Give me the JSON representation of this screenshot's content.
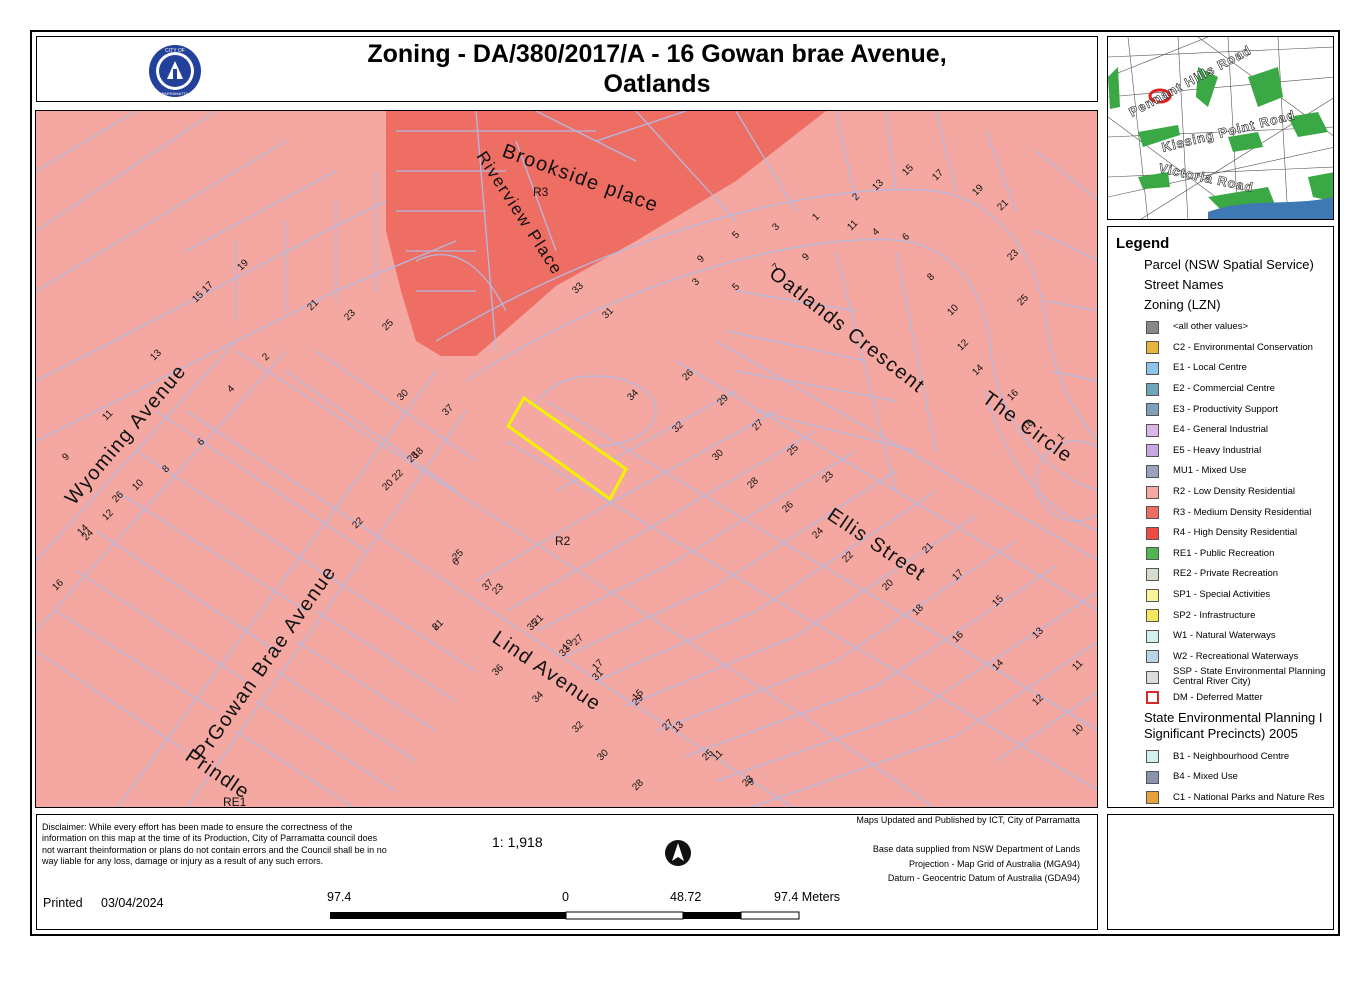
{
  "title": {
    "line1": "Zoning - DA/380/2017/A - 16 Gowan brae Avenue,",
    "line2": "Oatlands"
  },
  "logo": {
    "top_text": "CITY OF",
    "bottom_text": "PARRAMATTA"
  },
  "colors": {
    "R2": "#f4a8a1",
    "R3": "#ef6e64",
    "parcel_line": "#b3b9e0",
    "subject_outline": "#f2f200",
    "inset_green": "#3aa845"
  },
  "map": {
    "streets": {
      "wyoming": "Wyoming Avenue",
      "gowan_brae": "PrGowan Brae Avenue",
      "prindle": "Prindle",
      "lind": "Lind Avenue",
      "ellis": "Ellis Street",
      "oatlands_crescent": "Oatlands Crescent",
      "the_circle": "The Circle",
      "brookside": "Brookside place",
      "riverview": "Riverview Place"
    },
    "zone_labels": {
      "r3": "R3",
      "r2": "R2",
      "re1": "RE1"
    },
    "lot_numbers": [
      "19",
      "15 17",
      "13",
      "11",
      "9",
      "21",
      "23",
      "25",
      "33",
      "31",
      "16",
      "14",
      "12",
      "10",
      "8",
      "6",
      "4",
      "2",
      "30",
      "28",
      "26",
      "24",
      "22",
      "20 22",
      "18",
      "37",
      "27",
      "25",
      "23",
      "21",
      "19",
      "17",
      "15",
      "13",
      "11",
      "9",
      "34",
      "32",
      "30",
      "28",
      "26",
      "24",
      "22",
      "20",
      "18",
      "16",
      "14",
      "12",
      "10",
      "8",
      "6",
      "37",
      "35",
      "33",
      "31",
      "29",
      "27",
      "25",
      "23",
      "21",
      "36",
      "34",
      "32",
      "30",
      "28",
      "26",
      "29",
      "27",
      "25",
      "23",
      "21",
      "17",
      "15",
      "13",
      "11",
      "9",
      "5",
      "3",
      "1",
      "2",
      "4",
      "6",
      "8",
      "10",
      "12",
      "14",
      "16",
      "18",
      "1",
      "3",
      "5",
      "7",
      "9",
      "11",
      "13",
      "15",
      "17",
      "19",
      "21",
      "23",
      "25"
    ]
  },
  "inset": {
    "roads": [
      "Pennant Hills Road",
      "Kissing Point Road",
      "Victoria Road"
    ]
  },
  "legend": {
    "title": "Legend",
    "parcel": "Parcel (NSW Spatial Service)",
    "street_names": "Street Names",
    "zoning_heading": "Zoning (LZN)",
    "zoning_items": [
      {
        "label": "<all other values>",
        "color": "#888888"
      },
      {
        "label": "C2 - Environmental Conservation",
        "color": "#e6b63c"
      },
      {
        "label": "E1 - Local Centre",
        "color": "#8ec4ea"
      },
      {
        "label": "E2 - Commercial Centre",
        "color": "#6da6bb"
      },
      {
        "label": "E3 - Productivity Support",
        "color": "#7fa0b8"
      },
      {
        "label": "E4 - General Industrial",
        "color": "#ddb6e8"
      },
      {
        "label": "E5 - Heavy Industrial",
        "color": "#c6a8e0"
      },
      {
        "label": "MU1 - Mixed Use",
        "color": "#9aa2bd"
      },
      {
        "label": "R2 - Low Density Residential",
        "color": "#f4a8a1"
      },
      {
        "label": "R3 - Medium Density Residential",
        "color": "#ef6e64"
      },
      {
        "label": "R4 - High Density Residential",
        "color": "#f04b43"
      },
      {
        "label": "RE1 - Public Recreation",
        "color": "#52b554"
      },
      {
        "label": "RE2 - Private Recreation",
        "color": "#d4dccb"
      },
      {
        "label": "SP1 - Special Activities",
        "color": "#fbf49a"
      },
      {
        "label": "SP2 - Infrastructure",
        "color": "#f7e860"
      },
      {
        "label": "W1 - Natural Waterways",
        "color": "#d3eef0"
      },
      {
        "label": "W2 - Recreational Waterways",
        "color": "#b9d4e2"
      },
      {
        "label": "SSP - State Environmental Planning\nCentral River City)",
        "color": "#dcdcdc"
      },
      {
        "label": "DM - Deferred Matter",
        "color": "#ffffff",
        "outline": "#d42a2a"
      }
    ],
    "sepp_heading": "State Environmental Planning I\nSignificant Precincts) 2005",
    "sepp_items": [
      {
        "label": "B1 - Neighbourhood Centre",
        "color": "#d3eef0"
      },
      {
        "label": "B4 - Mixed Use",
        "color": "#8a94ae"
      },
      {
        "label": "C1 - National Parks and Nature Res",
        "color": "#e8a23c"
      }
    ]
  },
  "footer": {
    "disclaimer": "Disclaimer: While every effort has been made to ensure the correctness of the information on this map at the time of its Production, City of Parramatta council does not warrant theinformation or plans do not contain errors and the Council shall be in no way liable for any loss, damage or injury as a result of any such errors.",
    "printed_label": "Printed",
    "printed_date": "03/04/2024",
    "scale_ratio": "1: 1,918",
    "scale_labels": {
      "left": "97.4",
      "zero": "0",
      "mid": "48.72",
      "right": "97.4 Meters"
    },
    "credits": [
      "Maps Updated and Published by ICT, City of Parramatta",
      "",
      "Base data supplied from NSW Department of Lands",
      "Projection - Map Grid of Australia (MGA94)",
      "Datum - Geocentric Datum of Australia (GDA94)"
    ]
  }
}
